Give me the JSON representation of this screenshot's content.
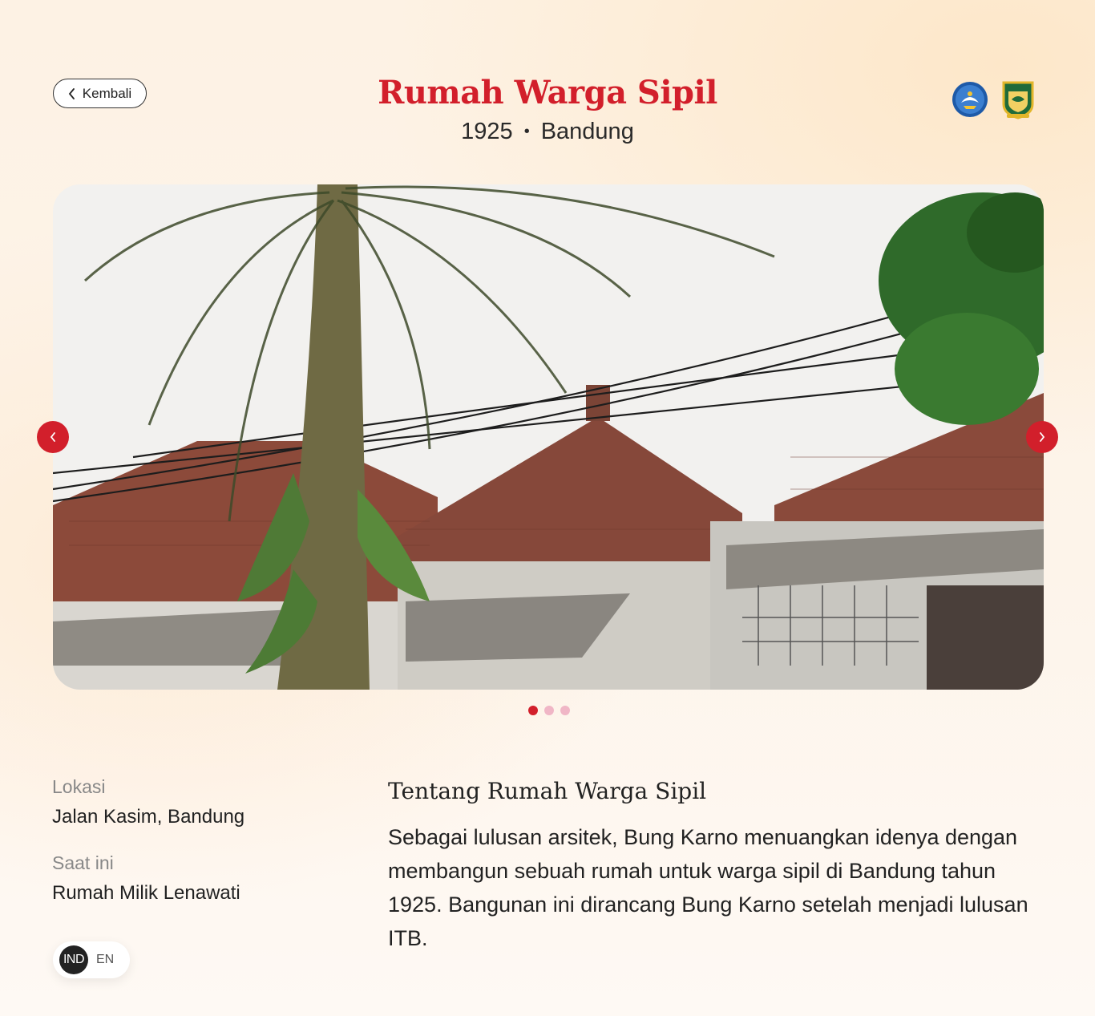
{
  "header": {
    "back_label": "Kembali",
    "title": "Rumah Warga Sipil",
    "year": "1925",
    "separator": "•",
    "city": "Bandung"
  },
  "carousel": {
    "slide_count": 3,
    "active_slide": 1
  },
  "details": {
    "location_label": "Lokasi",
    "location_value": "Jalan Kasim, Bandung",
    "current_label": "Saat ini",
    "current_value": "Rumah Milik Lenawati"
  },
  "about": {
    "heading": "Tentang Rumah Warga Sipil",
    "body": "Sebagai lulusan arsitek, Bung Karno menuangkan idenya dengan membangun sebuah rumah untuk warga sipil di Bandung tahun 1925. Bangunan ini dirancang Bung Karno setelah menjadi lulusan ITB."
  },
  "language": {
    "active": "IND",
    "inactive": "EN"
  },
  "colors": {
    "accent": "#d21f2b",
    "dot_inactive": "#f0b6c6"
  },
  "icons": [
    "chevron-left-icon",
    "chevron-right-icon",
    "kemdikbud-logo",
    "jabar-crest-logo"
  ]
}
